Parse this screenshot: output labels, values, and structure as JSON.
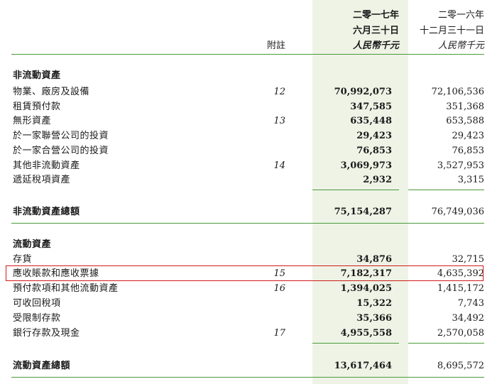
{
  "header": {
    "col2017_line1": "二零一七年",
    "col2017_line2": "六月三十日",
    "col2016_line1": "二零一六年",
    "col2016_line2": "十二月三十一日",
    "note_label": "附註",
    "unit_2017": "人民幣千元",
    "unit_2016": "人民幣千元"
  },
  "non_current": {
    "title": "非流動資產",
    "items": [
      {
        "label": "物業、廠房及設備",
        "note": "12",
        "v2017": "70,992,073",
        "v2016": "72,106,536"
      },
      {
        "label": "租賃預付款",
        "note": "",
        "v2017": "347,585",
        "v2016": "351,368"
      },
      {
        "label": "無形資產",
        "note": "13",
        "v2017": "635,448",
        "v2016": "653,588"
      },
      {
        "label": "於一家聯營公司的投資",
        "note": "",
        "v2017": "29,423",
        "v2016": "29,423"
      },
      {
        "label": "於一家合營公司的投資",
        "note": "",
        "v2017": "76,853",
        "v2016": "76,853"
      },
      {
        "label": "其他非流動資產",
        "note": "14",
        "v2017": "3,069,973",
        "v2016": "3,527,953"
      },
      {
        "label": "遞延稅項資產",
        "note": "",
        "v2017": "2,932",
        "v2016": "3,315"
      }
    ],
    "total_label": "非流動資產總額",
    "total_2017": "75,154,287",
    "total_2016": "76,749,036"
  },
  "current": {
    "title": "流動資產",
    "items": [
      {
        "label": "存貨",
        "note": "",
        "v2017": "34,876",
        "v2016": "32,715"
      },
      {
        "label": "應收賬款和應收票據",
        "note": "15",
        "v2017": "7,182,317",
        "v2016": "4,635,392"
      },
      {
        "label": "預付款項和其他流動資產",
        "note": "16",
        "v2017": "1,394,025",
        "v2016": "1,415,172"
      },
      {
        "label": "可收回稅項",
        "note": "",
        "v2017": "15,322",
        "v2016": "7,743"
      },
      {
        "label": "受限制存款",
        "note": "",
        "v2017": "35,366",
        "v2016": "34,492"
      },
      {
        "label": "銀行存款及現金",
        "note": "17",
        "v2017": "4,955,558",
        "v2016": "2,570,058"
      }
    ],
    "total_label": "流動資產總額",
    "total_2017": "13,617,464",
    "total_2016": "8,695,572"
  },
  "colors": {
    "rule": "#4a9a3a",
    "highlight_box": "#d11a1a",
    "column_shade": "#eef3e6"
  }
}
